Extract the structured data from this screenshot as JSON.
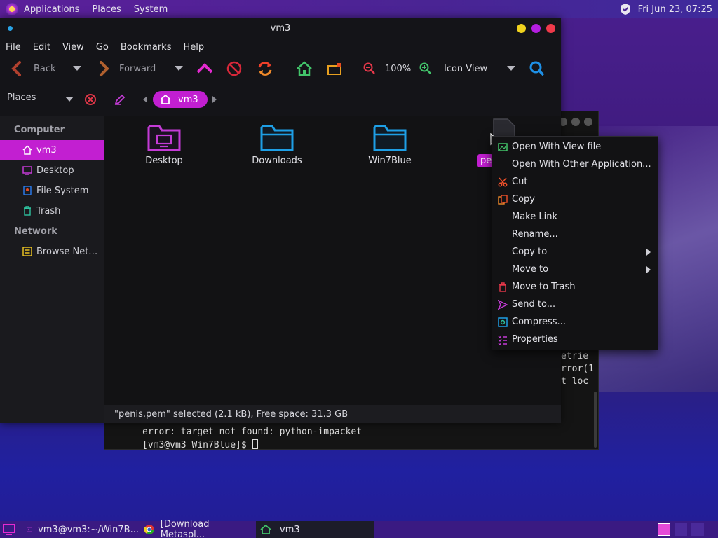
{
  "top_panel": {
    "menus": [
      "Applications",
      "Places",
      "System"
    ],
    "clock": "Fri Jun 23, 07:25"
  },
  "window": {
    "title": "vm3",
    "menu": [
      "File",
      "Edit",
      "View",
      "Go",
      "Bookmarks",
      "Help"
    ],
    "toolbar": {
      "back": "Back",
      "forward": "Forward",
      "zoom": "100%",
      "view_mode": "Icon View"
    },
    "location": {
      "places_label": "Places",
      "crumb": "vm3"
    },
    "sidebar": {
      "computer_heading": "Computer",
      "items": [
        "vm3",
        "Desktop",
        "File System",
        "Trash"
      ],
      "network_heading": "Network",
      "network_items": [
        "Browse Net…"
      ]
    },
    "files": [
      "Desktop",
      "Downloads",
      "Win7Blue"
    ],
    "partial_file_label": "pe",
    "status": "\"penis.pem\" selected (2.1 kB), Free space: 31.3 GB"
  },
  "context_menu": {
    "items": [
      "Open With View file",
      "Open With Other Application...",
      "Cut",
      "Copy",
      "Make Link",
      "Rename...",
      "Copy to",
      "Move to",
      "Move to Trash",
      "Send to...",
      "Compress...",
      "Properties"
    ]
  },
  "terminal": {
    "side_lines": [
      "etrie",
      "rror(1",
      "t loc"
    ],
    "error_line": "error: target not found: python-impacket",
    "prompt": "[vm3@vm3 Win7Blue]$ "
  },
  "taskbar": {
    "tasks": [
      "vm3@vm3:~/Win7B...",
      "[Download Metaspl...",
      "vm3"
    ]
  },
  "colors": {
    "accent": "#c21fd1",
    "folder_blue": "#1e9fe6",
    "folder_magenta": "#c43bd6"
  }
}
